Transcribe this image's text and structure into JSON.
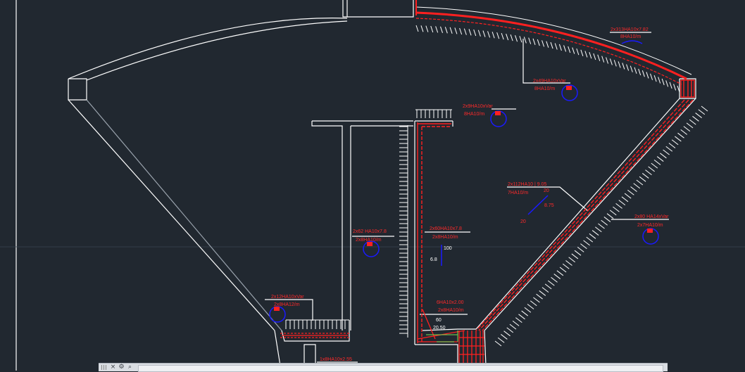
{
  "colors": {
    "background": "#212830",
    "structure": "#ffffff",
    "rebar": "#ff2020",
    "annotation_text": "#ff2a2a",
    "marker": "#1a1aff",
    "dimension_green": "#7adf55"
  },
  "labels": {
    "roof_line1": "2x313HA10x7.82",
    "roof_line2": "8HA10/m",
    "ring_line1": "2x49HA10xVar",
    "ring_line2": "8HA10/m",
    "top_line1": "2x9HA10xVar",
    "top_line2": "8HA10/m",
    "cone_line1": "2x112HA10 | 9.05",
    "cone_line2": "7HA10/m",
    "cone_right_line1": "2x80 HA14xVar",
    "cone_right_line2": "2x7HA10/m",
    "inner_left_line1": "2x62 HA10x7.8",
    "inner_left_line2": "2x8HA10/m",
    "inner_right_line1": "2x60HA10x7.8",
    "inner_right_line2": "2x8HA10/m",
    "base_left_line1": "2x12HA10xVar",
    "base_left_line2": "2x8HA12/m",
    "base_right_line1": "6HA10x2.00",
    "base_right_line2": "2x8HA10/m",
    "bottom_line1": "1x8HA10x2.55"
  },
  "dimensions": {
    "cone_dim_a": "20",
    "cone_dim_b": "8.75",
    "cone_dim_c": "20",
    "wall_dim_a": "100",
    "wall_dim_b": "6.8",
    "base_dim_a": "60",
    "base_dim_b": "20.50"
  },
  "icons": {
    "command_close": "close-icon",
    "command_settings": "wrench-icon",
    "command_search": "search-icon"
  }
}
